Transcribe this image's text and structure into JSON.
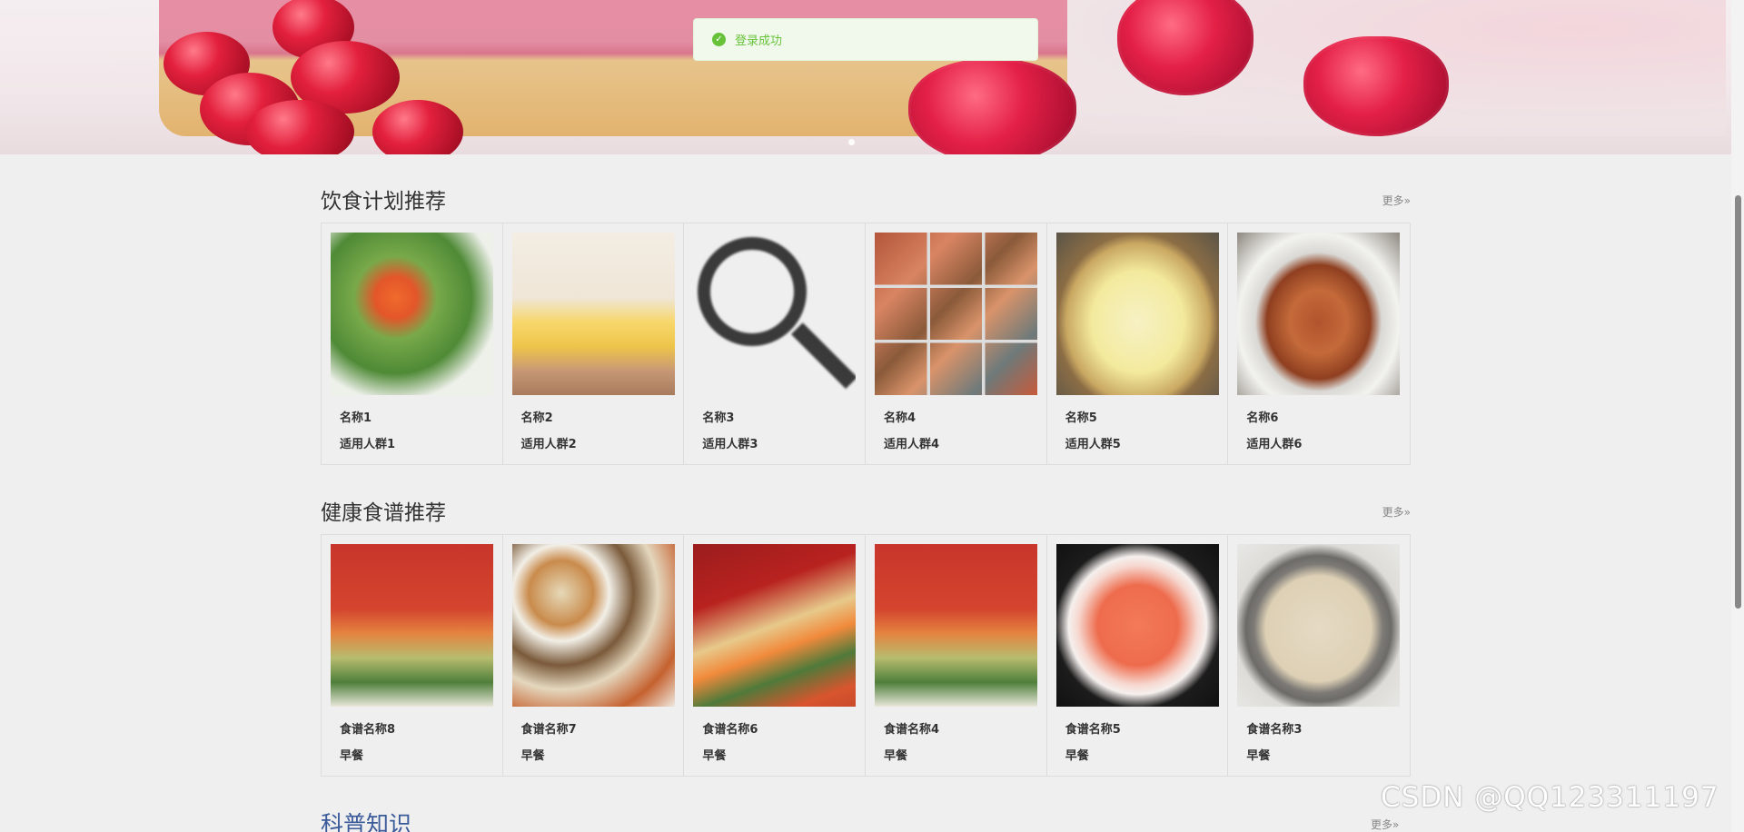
{
  "toast": {
    "text": "登录成功",
    "icon": "check-circle-icon",
    "color": "#67c23a"
  },
  "sections": [
    {
      "title": "饮食计划推荐",
      "more": "更多»",
      "items": [
        {
          "name": "名称1",
          "sub": "适用人群1"
        },
        {
          "name": "名称2",
          "sub": "适用人群2"
        },
        {
          "name": "名称3",
          "sub": "适用人群3"
        },
        {
          "name": "名称4",
          "sub": "适用人群4"
        },
        {
          "name": "名称5",
          "sub": "适用人群5"
        },
        {
          "name": "名称6",
          "sub": "适用人群6"
        }
      ]
    },
    {
      "title": "健康食谱推荐",
      "more": "更多»",
      "items": [
        {
          "name": "食谱名称8",
          "sub": "早餐"
        },
        {
          "name": "食谱名称7",
          "sub": "早餐"
        },
        {
          "name": "食谱名称6",
          "sub": "早餐"
        },
        {
          "name": "食谱名称4",
          "sub": "早餐"
        },
        {
          "name": "食谱名称5",
          "sub": "早餐"
        },
        {
          "name": "食谱名称3",
          "sub": "早餐"
        }
      ]
    },
    {
      "title": "科普知识",
      "more": "更多»"
    }
  ],
  "watermark": "CSDN @QQ123311197"
}
